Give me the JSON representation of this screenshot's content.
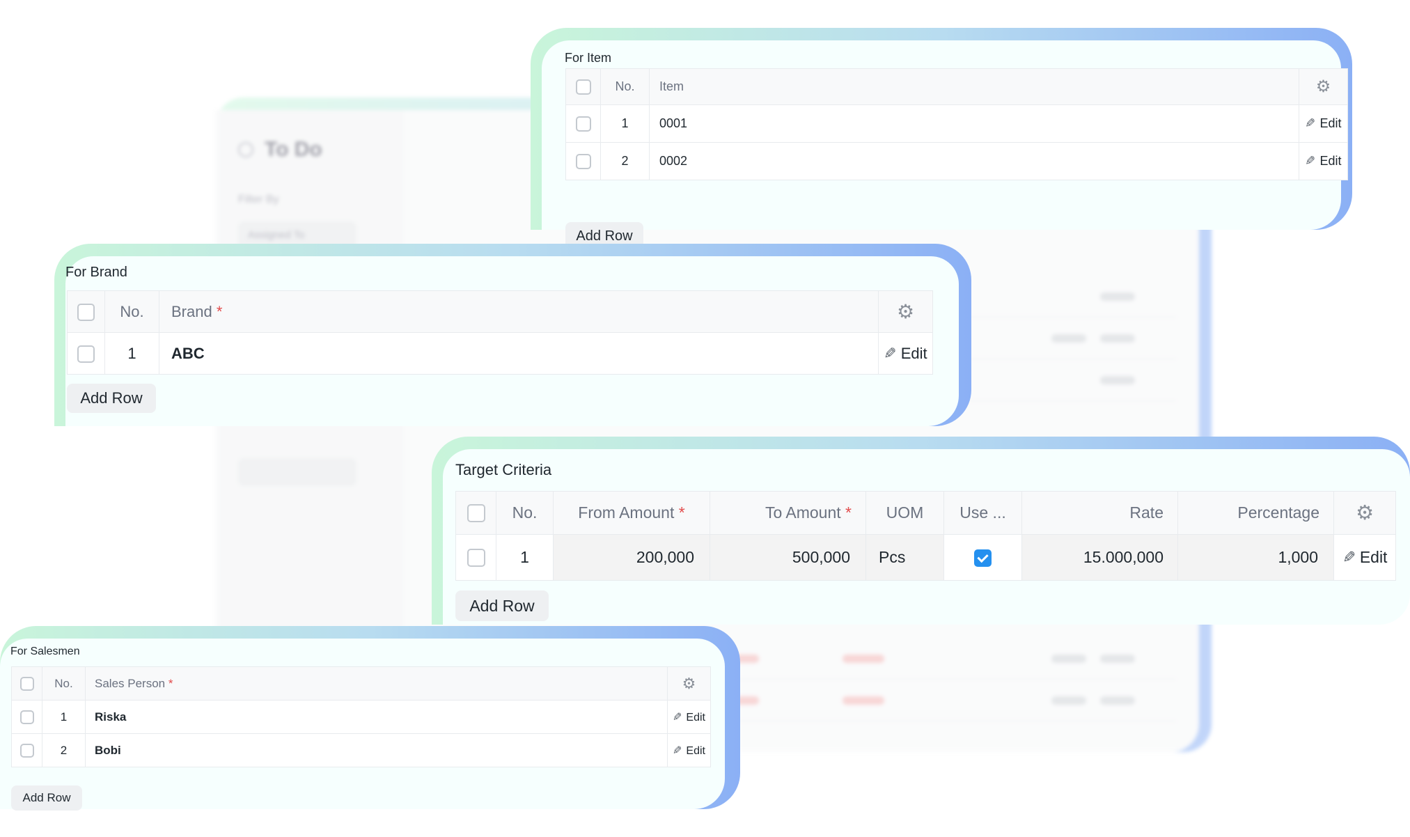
{
  "background": {
    "title": "To Do",
    "filter_label": "Filter By",
    "filter_value": "Assigned To"
  },
  "item_section": {
    "title": "For Item",
    "headers": {
      "no": "No.",
      "item": "Item"
    },
    "rows": [
      {
        "no": "1",
        "item": "0001",
        "edit": "Edit"
      },
      {
        "no": "2",
        "item": "0002",
        "edit": "Edit"
      }
    ],
    "add_row": "Add Row"
  },
  "brand_section": {
    "title": "For Brand",
    "headers": {
      "no": "No.",
      "brand": "Brand",
      "required": "*"
    },
    "rows": [
      {
        "no": "1",
        "brand": "ABC",
        "edit": "Edit"
      }
    ],
    "add_row": "Add Row"
  },
  "target_section": {
    "title": "Target Criteria",
    "headers": {
      "no": "No.",
      "from_amount": "From Amount",
      "to_amount": "To Amount",
      "uom": "UOM",
      "use": "Use ...",
      "rate": "Rate",
      "percentage": "Percentage",
      "required": "*"
    },
    "rows": [
      {
        "no": "1",
        "from_amount": "200,000",
        "to_amount": "500,000",
        "uom": "Pcs",
        "use_checked": true,
        "rate": "15.000,000",
        "percentage": "1,000",
        "edit": "Edit"
      }
    ],
    "add_row": "Add Row"
  },
  "salesmen_section": {
    "title": "For Salesmen",
    "headers": {
      "no": "No.",
      "sales_person": "Sales Person",
      "required": "*"
    },
    "rows": [
      {
        "no": "1",
        "sales_person": "Riska",
        "edit": "Edit"
      },
      {
        "no": "2",
        "sales_person": "Bobi",
        "edit": "Edit"
      }
    ],
    "add_row": "Add Row"
  },
  "icons": {
    "settings": "gear-icon",
    "edit": "pencil-icon",
    "checkbox": "checkbox"
  },
  "colors": {
    "accent": "#2490ef",
    "required": "#e24c4c",
    "gradient_start": "#c9f5da",
    "gradient_end": "#8bb0f5"
  }
}
